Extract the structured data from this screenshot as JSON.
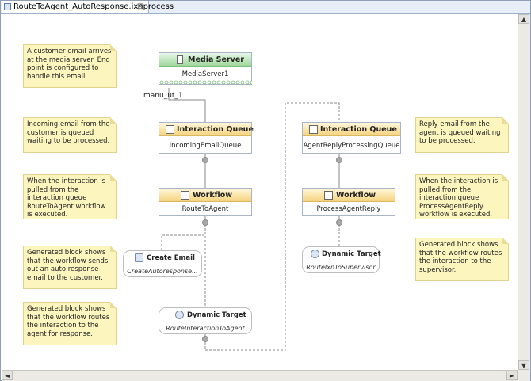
{
  "tab": {
    "title": "RouteToAgent_AutoResponse.ixnprocess",
    "close": "⊠"
  },
  "notes": [
    "A customer email arrives at the media server. End point is configured to handle this email.",
    "Incoming email from the customer is queued waiting to be processed.",
    "When the interaction is pulled from the interaction queue RouteToAgent workflow is executed.",
    "Generated block shows that the workflow sends out an auto response email to the customer.",
    "Generated block shows that the workflow routes the interaction to the agent for response.",
    "Reply email from the agent is queued waiting to be processed.",
    "When the interaction is pulled from the interaction queue ProcessAgentReply workflow is executed.",
    "Generated block shows that the workflow routes the interaction to the supervisor."
  ],
  "media_server": {
    "title": "Media Server",
    "name": "MediaServer1",
    "endpoint_label": "manu_ut_1"
  },
  "left_flow": {
    "queue": {
      "title": "Interaction Queue",
      "name": "IncomingEmailQueue"
    },
    "workflow": {
      "title": "Workflow",
      "name": "RouteToAgent"
    },
    "create_email": {
      "title": "Create Email",
      "name": "CreateAutoresponse..."
    },
    "dynamic_target": {
      "title": "Dynamic Target",
      "name": "RouteInteractionToAgent"
    }
  },
  "right_flow": {
    "queue": {
      "title": "Interaction Queue",
      "name": "AgentReplyProcessingQueue"
    },
    "workflow": {
      "title": "Workflow",
      "name": "ProcessAgentReply"
    },
    "dynamic_target": {
      "title": "Dynamic Target",
      "name": "RouteIxnToSupervisor"
    }
  },
  "scrollbar": {
    "up": "▲",
    "down": "▼",
    "left": "◄",
    "right": "►"
  },
  "colors": {
    "note": "#fdf5be",
    "queue_header": "#f5d37e",
    "media_header": "#9fd89a",
    "connector": "#8a8a8a"
  }
}
